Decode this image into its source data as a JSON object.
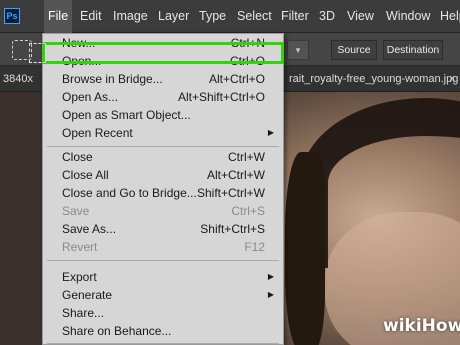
{
  "app": {
    "logo": "Ps"
  },
  "menubar": {
    "items": [
      "File",
      "Edit",
      "Image",
      "Layer",
      "Type",
      "Select",
      "Filter",
      "3D",
      "View",
      "Window",
      "Help"
    ],
    "active": "File"
  },
  "options": {
    "tool_icon": "patch-tool-icon",
    "dropdown_caret": "▾",
    "source_label": "Source",
    "destination_label": "Destination"
  },
  "document": {
    "size_prefix": "3840x",
    "tab_title": "rait_royalty-free_young-woman.jpg @",
    "close_glyph": "×"
  },
  "file_menu": [
    {
      "label": "New...",
      "shortcut": "Ctrl+N",
      "enabled": true
    },
    {
      "label": "Open...",
      "shortcut": "Ctrl+O",
      "enabled": true,
      "highlighted": true
    },
    {
      "label": "Browse in Bridge...",
      "shortcut": "Alt+Ctrl+O",
      "enabled": true
    },
    {
      "label": "Open As...",
      "shortcut": "Alt+Shift+Ctrl+O",
      "enabled": true
    },
    {
      "label": "Open as Smart Object...",
      "shortcut": "",
      "enabled": true
    },
    {
      "label": "Open Recent",
      "shortcut": "",
      "enabled": true,
      "submenu": true
    },
    {
      "separator": true
    },
    {
      "label": "Close",
      "shortcut": "Ctrl+W",
      "enabled": true
    },
    {
      "label": "Close All",
      "shortcut": "Alt+Ctrl+W",
      "enabled": true
    },
    {
      "label": "Close and Go to Bridge...",
      "shortcut": "Shift+Ctrl+W",
      "enabled": true
    },
    {
      "label": "Save",
      "shortcut": "Ctrl+S",
      "enabled": false
    },
    {
      "label": "Save As...",
      "shortcut": "Shift+Ctrl+S",
      "enabled": true
    },
    {
      "label": "Revert",
      "shortcut": "F12",
      "enabled": false
    },
    {
      "separator": true
    },
    {
      "label": "Export",
      "shortcut": "",
      "enabled": true,
      "submenu": true
    },
    {
      "label": "Generate",
      "shortcut": "",
      "enabled": true,
      "submenu": true
    },
    {
      "label": "Share...",
      "shortcut": "",
      "enabled": true
    },
    {
      "label": "Share on Behance...",
      "shortcut": "",
      "enabled": true
    },
    {
      "separator": true
    }
  ],
  "colors": {
    "highlight_box": "#36d10e",
    "menu_selection": "#1e6fc9"
  },
  "watermark": {
    "wiki": "wiki",
    "how": "How"
  }
}
